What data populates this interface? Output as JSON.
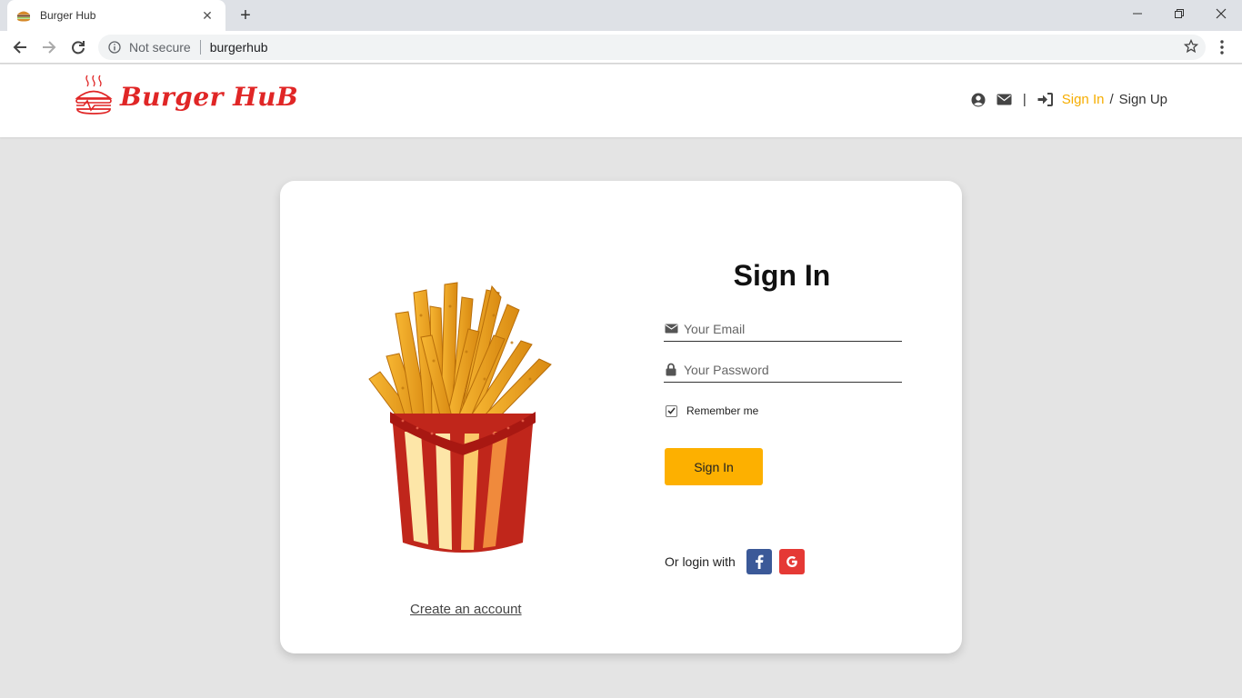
{
  "browser": {
    "tab_title": "Burger Hub",
    "tab_close": "✕",
    "new_tab": "+",
    "security_label": "Not secure",
    "url": "burgerhub"
  },
  "header": {
    "logo_text": "Burger HuB",
    "signin_label": "Sign In",
    "separator": "/",
    "signup_label": "Sign Up"
  },
  "login": {
    "title": "Sign In",
    "email_placeholder": "Your Email",
    "password_placeholder": "Your Password",
    "remember_label": "Remember me",
    "remember_checked": true,
    "signin_button": "Sign In",
    "social_label": "Or login with",
    "create_account": "Create an account"
  },
  "colors": {
    "accent": "#fdb000",
    "brand_red": "#e02626",
    "facebook": "#3b5998",
    "google": "#e53935"
  },
  "icons": [
    "user-circle-icon",
    "envelope-icon",
    "sign-in-icon",
    "lock-icon",
    "facebook-icon",
    "google-icon",
    "fries-image"
  ]
}
